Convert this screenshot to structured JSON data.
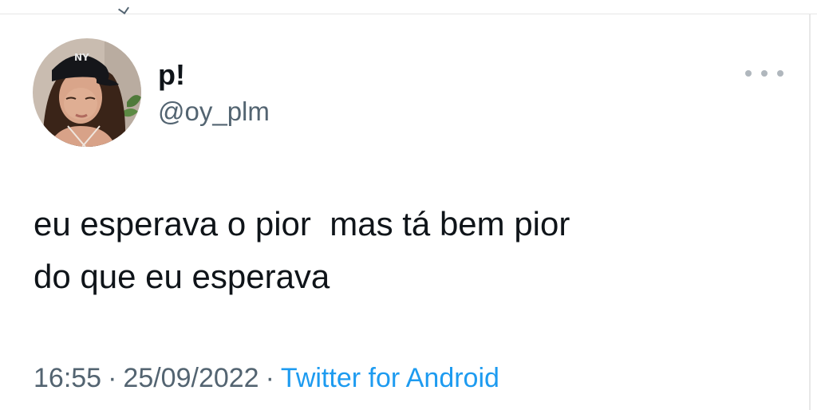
{
  "tweet": {
    "author": {
      "display_name": "p!",
      "handle": "@oy_plm",
      "avatar": "profile-photo"
    },
    "text_line_1": "eu esperava o pior  mas tá bem pior",
    "text_line_2": "do que eu esperava",
    "time": "16:55",
    "separator": "·",
    "date": "25/09/2022",
    "source": "Twitter for Android",
    "more_icon": "more-horizontal-icon"
  },
  "colors": {
    "text_primary": "#0f1419",
    "text_secondary": "#536471",
    "link": "#1d9bf0"
  }
}
